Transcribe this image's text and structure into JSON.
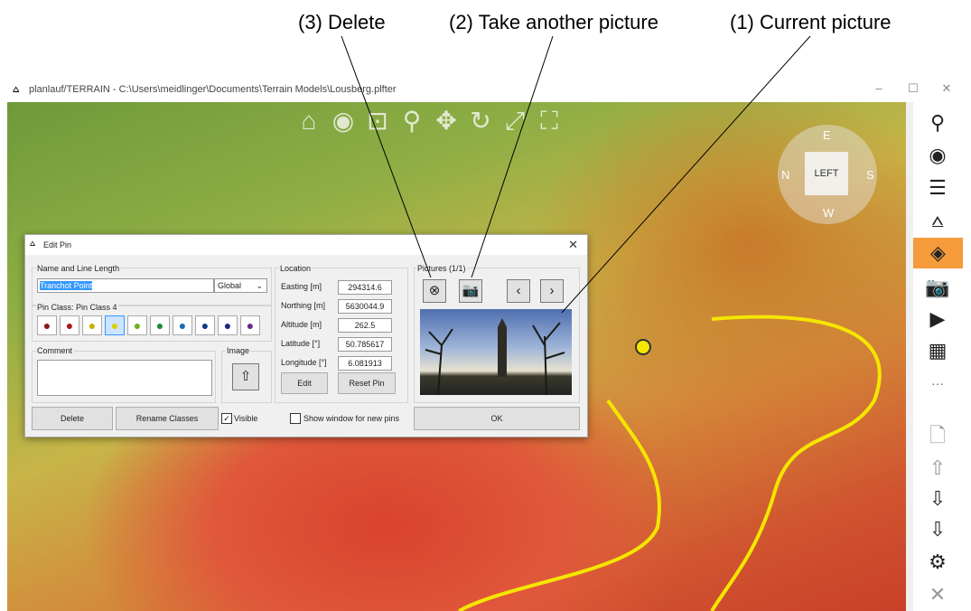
{
  "callouts": {
    "delete": "(3) Delete",
    "take_another": "(2) Take another picture",
    "current": "(1) Current picture"
  },
  "window": {
    "title": "planlauf/TERRAIN - C:\\Users\\meidlinger\\Documents\\Terrain Models\\Lousberg.plfter",
    "minimize": "–",
    "maximize": "☐",
    "close": "✕"
  },
  "navcube": {
    "face": "LEFT",
    "compass_n": "N",
    "compass_s": "S",
    "compass_w": "W",
    "compass_e": "E"
  },
  "dialog": {
    "title": "Edit Pin",
    "close": "✕",
    "name_group": "Name and Line Length",
    "name_value": "Tranchot Point",
    "scope_select": "Global",
    "pin_class_label": "Pin Class: Pin Class 4",
    "pin_colors": [
      "#8b1a1a",
      "#b01818",
      "#c9b000",
      "#d8d000",
      "#6fb020",
      "#1a8a3a",
      "#1a6ab0",
      "#103a8a",
      "#1a2a7a",
      "#6a2a8a"
    ],
    "comment_label": "Comment",
    "image_label": "Image",
    "location_label": "Location",
    "easting_label": "Easting [m]",
    "easting": "294314.6",
    "northing_label": "Northing [m]",
    "northing": "5630044.9",
    "altitude_label": "Altitude [m]",
    "altitude": "262.5",
    "latitude_label": "Latitude [°]",
    "latitude": "50.785617",
    "longitude_label": "Longitude [°]",
    "longitude": "6.081913",
    "edit": "Edit",
    "reset_pin": "Reset Pin",
    "pictures_label": "Pictures (1/1)",
    "delete": "Delete",
    "rename_classes": "Rename Classes",
    "visible_label": "Visible",
    "show_window_label": "Show window for new pins",
    "ok": "OK"
  },
  "colors": {
    "accent": "#f59b3c",
    "road": "#f5e600",
    "selection": "#3399ff"
  }
}
